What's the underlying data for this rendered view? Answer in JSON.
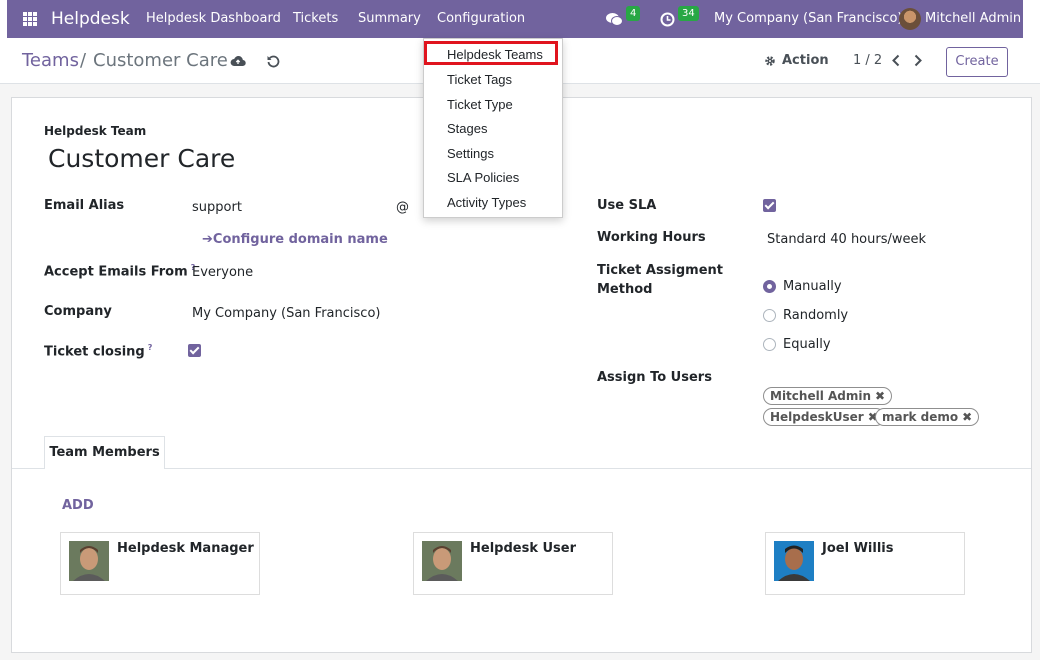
{
  "topbar": {
    "app_name": "Helpdesk",
    "menu": [
      "Helpdesk Dashboard",
      "Tickets",
      "Summary",
      "Configuration"
    ],
    "messages_count": "4",
    "activities_count": "34",
    "company": "My Company (San Francisco)",
    "user": "Mitchell Admin"
  },
  "control_panel": {
    "breadcrumb_parent": "Teams",
    "breadcrumb_sep": "/",
    "breadcrumb_current": "Customer Care",
    "action_label": "Action",
    "pager": "1 / 2",
    "create_label": "Create"
  },
  "configuration_menu": [
    "Helpdesk Teams",
    "Ticket Tags",
    "Ticket Type",
    "Stages",
    "Settings",
    "SLA Policies",
    "Activity Types"
  ],
  "form": {
    "team_label": "Helpdesk Team",
    "team_name": "Customer Care",
    "email_alias_label": "Email Alias",
    "email_alias_value": "support",
    "at_sign": "@",
    "configure_domain": "Configure domain name",
    "accept_emails_label": "Accept Emails From",
    "accept_emails_value": "Everyone",
    "company_label": "Company",
    "company_value": "My Company (San Francisco)",
    "ticket_closing_label": "Ticket closing",
    "help_mark": "?",
    "use_sla_label": "Use SLA",
    "working_hours_label": "Working Hours",
    "working_hours_value": "Standard 40 hours/week",
    "assignment_label_1": "Ticket Assigment",
    "assignment_label_2": "Method",
    "assignment_options": [
      "Manually",
      "Randomly",
      "Equally"
    ],
    "assign_users_label": "Assign To Users",
    "assigned_users": [
      "Mitchell Admin",
      "HelpdeskUser",
      "mark demo"
    ]
  },
  "tabs": {
    "team_members": "Team Members",
    "add_label": "ADD",
    "members": [
      "Helpdesk Manager",
      "Helpdesk User",
      "Joel Willis"
    ]
  },
  "colors": {
    "brand": "#71639e",
    "badge": "#28a745",
    "highlight": "#e0141e"
  }
}
